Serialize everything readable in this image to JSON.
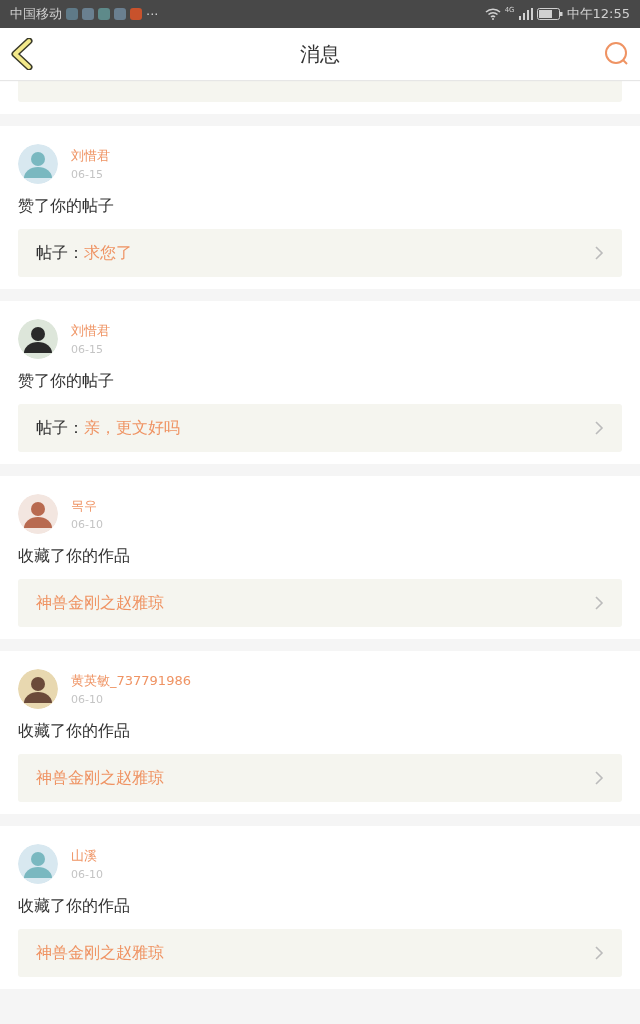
{
  "status_bar": {
    "carrier": "中国移动",
    "more": "···",
    "network": "4G",
    "time": "中午12:55"
  },
  "header": {
    "title": "消息"
  },
  "messages": [
    {
      "kind": "cut"
    },
    {
      "kind": "post",
      "user": "刘惜君",
      "date": "06-15",
      "action": "赞了你的帖子",
      "link": {
        "prefix": "帖子：",
        "title": "求您了"
      }
    },
    {
      "kind": "post",
      "user": "刘惜君",
      "date": "06-15",
      "action": "赞了你的帖子",
      "link": {
        "prefix": "帖子：",
        "title": "亲，更文好吗"
      }
    },
    {
      "kind": "work",
      "user": "목우",
      "date": "06-10",
      "action": "收藏了你的作品",
      "link": {
        "title": "神兽金刚之赵雅琼"
      }
    },
    {
      "kind": "work",
      "user": "黄英敏_737791986",
      "date": "06-10",
      "action": "收藏了你的作品",
      "link": {
        "title": "神兽金刚之赵雅琼"
      }
    },
    {
      "kind": "work",
      "user": "山溪",
      "date": "06-10",
      "action": "收藏了你的作品",
      "link": {
        "title": "神兽金刚之赵雅琼"
      }
    }
  ]
}
